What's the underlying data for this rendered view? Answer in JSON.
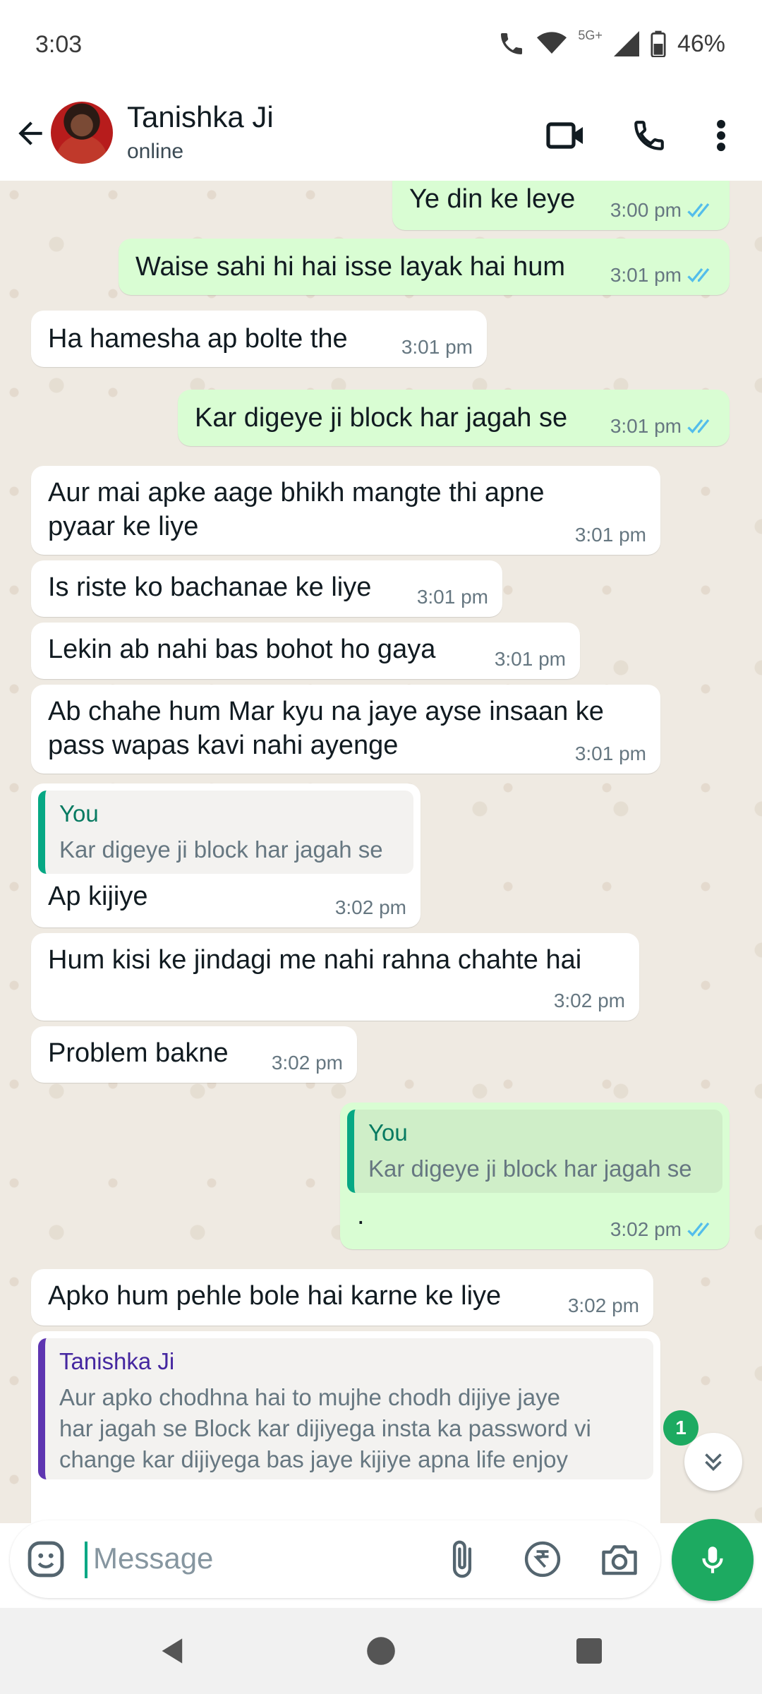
{
  "status_bar": {
    "time": "3:03",
    "network_label": "5G+",
    "battery": "46%"
  },
  "header": {
    "contact_name": "Tanishka Ji",
    "status": "online",
    "icons": [
      "back-arrow-icon",
      "video-call-icon",
      "voice-call-icon",
      "more-vert-icon"
    ]
  },
  "messages": [
    {
      "dir": "out",
      "text": "Ye din ke leye",
      "time": "3:00 pm",
      "read": true
    },
    {
      "dir": "out",
      "text": "Waise sahi hi hai isse layak hai hum",
      "time": "3:01 pm",
      "read": true
    },
    {
      "dir": "in",
      "text": "Ha hamesha ap bolte the",
      "time": "3:01 pm"
    },
    {
      "dir": "out",
      "text": "Kar digeye ji block har jagah se",
      "time": "3:01 pm",
      "read": true
    },
    {
      "dir": "in",
      "text": "Aur mai apke aage bhikh mangte thi apne\npyaar ke liye",
      "time": "3:01 pm"
    },
    {
      "dir": "in",
      "text": "Is riste ko bachanae ke liye",
      "time": "3:01 pm"
    },
    {
      "dir": "in",
      "text": "Lekin ab nahi bas bohot ho gaya",
      "time": "3:01 pm"
    },
    {
      "dir": "in",
      "text": "Ab chahe hum Mar kyu na jaye ayse insaan ke\npass wapas kavi nahi ayenge",
      "time": "3:01 pm"
    },
    {
      "dir": "in",
      "quote_name": "You",
      "quote_text": "Kar digeye ji block har jagah se",
      "text": "Ap kijiye",
      "time": "3:02 pm"
    },
    {
      "dir": "in",
      "text": "Hum kisi ke jindagi me nahi rahna chahte hai",
      "time": "3:02 pm"
    },
    {
      "dir": "in",
      "text": "Problem bakne",
      "time": "3:02 pm"
    },
    {
      "dir": "out",
      "quote_name": "You",
      "quote_text": "Kar digeye ji block har jagah se",
      "text": ".",
      "time": "3:02 pm",
      "read": true
    },
    {
      "dir": "in",
      "text": "Apko hum pehle bole hai karne ke liye",
      "time": "3:02 pm"
    },
    {
      "dir": "in",
      "quote_name": "Tanishka Ji",
      "quote_text": "Aur apko chodhna hai to mujhe chodh dijiye jaye\nhar jagah se Block kar dijiyega insta ka password vi\nchange kar dijiyega bas jaye kijiye apna life enjoy",
      "text": ""
    }
  ],
  "unread_badge": "1",
  "composer": {
    "placeholder": "Message"
  },
  "colors": {
    "accent": "#1daa61",
    "outgoing_bubble": "#d9fdd3",
    "incoming_bubble": "#ffffff",
    "chat_background": "#efeae2",
    "read_ticks": "#53bdeb"
  }
}
